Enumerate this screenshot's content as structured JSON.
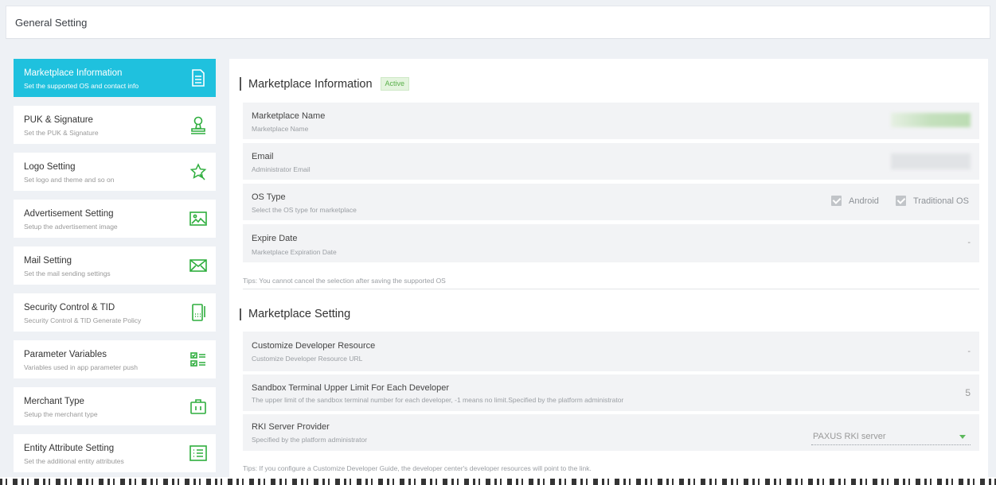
{
  "header": {
    "title": "General Setting"
  },
  "sidebar": {
    "items": [
      {
        "label": "Marketplace Information",
        "sub": "Set the supported OS and contact info",
        "icon": "document-icon",
        "active": true
      },
      {
        "label": "PUK & Signature",
        "sub": "Set the PUK & Signature",
        "icon": "stamp-icon"
      },
      {
        "label": "Logo Setting",
        "sub": "Set logo and theme and so on",
        "icon": "star-icon"
      },
      {
        "label": "Advertisement Setting",
        "sub": "Setup the advertisement image",
        "icon": "image-icon"
      },
      {
        "label": "Mail Setting",
        "sub": "Set the mail sending settings",
        "icon": "mail-icon"
      },
      {
        "label": "Security Control & TID",
        "sub": "Security Control & TID Generate Policy",
        "icon": "terminal-icon"
      },
      {
        "label": "Parameter Variables",
        "sub": "Variables used in app parameter push",
        "icon": "checklist-icon"
      },
      {
        "label": "Merchant Type",
        "sub": "Setup the merchant type",
        "icon": "briefcase-icon"
      },
      {
        "label": "Entity Attribute Setting",
        "sub": "Set the additional entity attributes",
        "icon": "list-icon"
      }
    ]
  },
  "info": {
    "title": "Marketplace Information",
    "badge": "Active",
    "rows": [
      {
        "label": "Marketplace Name",
        "sub": "Marketplace Name"
      },
      {
        "label": "Email",
        "sub": "Administrator Email"
      },
      {
        "label": "OS Type",
        "sub": "Select the OS type for marketplace",
        "options": [
          "Android",
          "Traditional OS"
        ]
      },
      {
        "label": "Expire Date",
        "sub": "Marketplace Expiration Date",
        "value": "-"
      }
    ],
    "tips": "Tips: You cannot cancel the selection after saving the supported OS"
  },
  "setting": {
    "title": "Marketplace Setting",
    "rows": [
      {
        "label": "Customize Developer Resource",
        "sub": "Customize Developer Resource URL",
        "value": "-"
      },
      {
        "label": "Sandbox Terminal Upper Limit For Each Developer",
        "sub": "The upper limit of the sandbox terminal number for each developer, -1 means no limit.Specified by the platform administrator",
        "value": "5"
      },
      {
        "label": "RKI Server Provider",
        "sub": "Specified by the platform administrator",
        "value": "PAXUS RKI server"
      }
    ],
    "tips": "Tips: If you configure a Customize Developer Guide, the developer center's developer resources will point to the link."
  },
  "colors": {
    "accent": "#1fc1de",
    "badge_bg": "#e4f4de",
    "badge_text": "#5ab04a"
  }
}
